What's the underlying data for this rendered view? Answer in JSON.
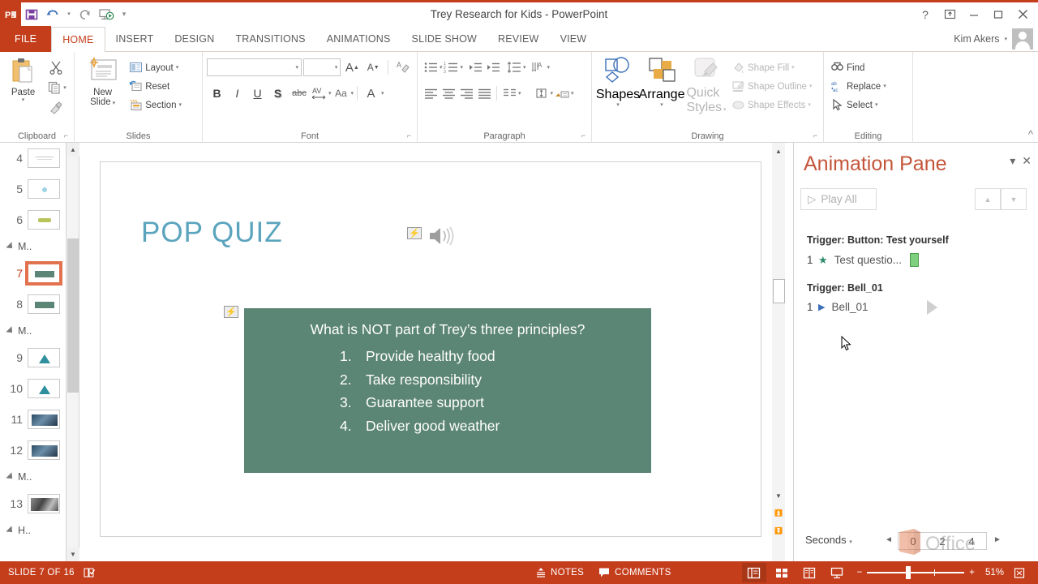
{
  "window": {
    "title": "Trey Research for Kids - PowerPoint",
    "user": "Kim Akers",
    "help": "?",
    "ribbon_display": "ribbon-display-options",
    "minimize": "—",
    "maximize": "▢",
    "close": "✕"
  },
  "quick_access": {
    "logo": "P",
    "items": [
      {
        "name": "save-button",
        "icon": "save-icon"
      },
      {
        "name": "undo-button",
        "icon": "undo-icon"
      },
      {
        "name": "redo-button",
        "icon": "redo-icon"
      },
      {
        "name": "start-slideshow-button",
        "icon": "slideshow-icon"
      },
      {
        "name": "customize-qat-button",
        "icon": "chevron-down-icon"
      }
    ]
  },
  "tabs": [
    {
      "label": "FILE",
      "active": false,
      "file": true
    },
    {
      "label": "HOME",
      "active": true
    },
    {
      "label": "INSERT",
      "active": false
    },
    {
      "label": "DESIGN",
      "active": false
    },
    {
      "label": "TRANSITIONS",
      "active": false
    },
    {
      "label": "ANIMATIONS",
      "active": false
    },
    {
      "label": "SLIDE SHOW",
      "active": false
    },
    {
      "label": "REVIEW",
      "active": false
    },
    {
      "label": "VIEW",
      "active": false
    }
  ],
  "ribbon": {
    "clipboard": {
      "label": "Clipboard",
      "paste": "Paste",
      "cut": "Cut",
      "copy": "Copy",
      "format_painter": "Format Painter"
    },
    "slides": {
      "label": "Slides",
      "new_slide_line1": "New",
      "new_slide_line2": "Slide",
      "layout": "Layout",
      "reset": "Reset",
      "section": "Section"
    },
    "font": {
      "label": "Font",
      "font_name": "",
      "font_name_placeholder": "",
      "font_size": "",
      "font_size_placeholder": "",
      "grow_font": "A",
      "shrink_font": "A",
      "clear_formatting": "Clear All Formatting",
      "bold": "B",
      "italic": "I",
      "underline": "U",
      "shadow": "S",
      "strikethrough": "abc",
      "character_spacing": "AV",
      "change_case": "Aa",
      "font_color": "A"
    },
    "paragraph": {
      "label": "Paragraph",
      "bullets": "Bullets",
      "numbering": "Numbering",
      "decrease_indent": "Decrease List Level",
      "increase_indent": "Increase List Level",
      "line_spacing": "Line Spacing",
      "text_direction": "Text Direction",
      "align_text": "Align Text",
      "convert_smartart": "Convert to SmartArt",
      "align_left": "Align Left",
      "align_center": "Center",
      "align_right": "Align Right",
      "justify": "Justify",
      "columns": "Columns"
    },
    "drawing": {
      "label": "Drawing",
      "shapes": "Shapes",
      "arrange": "Arrange",
      "quick_styles_line1": "Quick",
      "quick_styles_line2": "Styles",
      "shape_fill": "Shape Fill",
      "shape_outline": "Shape Outline",
      "shape_effects": "Shape Effects"
    },
    "editing": {
      "label": "Editing",
      "find": "Find",
      "replace": "Replace",
      "select": "Select"
    },
    "collapse": "collapse-ribbon-icon"
  },
  "thumbnails": {
    "rows": [
      {
        "type": "slide",
        "number": "4",
        "thumb": "text-lines",
        "selected": false
      },
      {
        "type": "slide",
        "number": "5",
        "thumb": "blue-dot",
        "selected": false
      },
      {
        "type": "slide",
        "number": "6",
        "thumb": "olive-bar",
        "selected": false
      },
      {
        "type": "section",
        "label": "M.."
      },
      {
        "type": "slide",
        "number": "7",
        "thumb": "green-bar",
        "selected": true
      },
      {
        "type": "slide",
        "number": "8",
        "thumb": "green-bar",
        "selected": false
      },
      {
        "type": "section",
        "label": "M.."
      },
      {
        "type": "slide",
        "number": "9",
        "thumb": "teal-triangle",
        "selected": false
      },
      {
        "type": "slide",
        "number": "10",
        "thumb": "teal-triangle",
        "selected": false
      },
      {
        "type": "slide",
        "number": "11",
        "thumb": "photo-dark",
        "selected": false
      },
      {
        "type": "slide",
        "number": "12",
        "thumb": "photo-dark",
        "selected": false
      },
      {
        "type": "section",
        "label": "M.."
      },
      {
        "type": "slide",
        "number": "13",
        "thumb": "photo-grey",
        "selected": false
      }
    ]
  },
  "slide": {
    "title": "POP QUIZ",
    "title_color": "#5ba4bd",
    "box_color": "#5b8574",
    "question": "What is NOT part of Trey’s three principles?",
    "answers": [
      {
        "n": "1.",
        "text": "Provide healthy food"
      },
      {
        "n": "2.",
        "text": "Take responsibility"
      },
      {
        "n": "3.",
        "text": "Guarantee support"
      },
      {
        "n": "4.",
        "text": "Deliver good weather"
      }
    ],
    "audio_icon": "speaker-icon",
    "anim_badge_title": "animation-trigger-badge",
    "anim_badge_box": "animation-trigger-badge"
  },
  "animation_pane": {
    "title": "Animation Pane",
    "collapse_icon": "chevron-down-icon",
    "close_icon": "close-icon",
    "play_all": "Play All",
    "move_up": "move-up-icon",
    "move_down": "move-down-icon",
    "groups": [
      {
        "header": "Trigger: Button: Test yourself",
        "items": [
          {
            "index": "1",
            "marker": "star",
            "label": "Test questio...",
            "bar": "green"
          }
        ]
      },
      {
        "header": "Trigger: Bell_01",
        "items": [
          {
            "index": "1",
            "marker": "play",
            "label": "Bell_01",
            "bar": "outline"
          }
        ]
      }
    ],
    "footer": {
      "seconds": "Seconds",
      "prev": "◄",
      "next": "►",
      "ticks": [
        "0",
        "2",
        "4"
      ],
      "watermark": "Office"
    }
  },
  "status_bar": {
    "slide_indicator": "SLIDE 7 OF 16",
    "spellcheck_icon": "spellcheck-icon",
    "notes": "NOTES",
    "comments": "COMMENTS",
    "views": [
      {
        "name": "normal-view-button",
        "icon": "normal-view-icon",
        "active": true
      },
      {
        "name": "slide-sorter-button",
        "icon": "slide-sorter-icon",
        "active": false
      },
      {
        "name": "reading-view-button",
        "icon": "reading-view-icon",
        "active": false
      },
      {
        "name": "slideshow-button",
        "icon": "slideshow-play-icon",
        "active": false
      }
    ],
    "zoom_out": "−",
    "zoom_in": "+",
    "zoom_level": "51%",
    "fit_to_window": "fit-slide-icon"
  }
}
